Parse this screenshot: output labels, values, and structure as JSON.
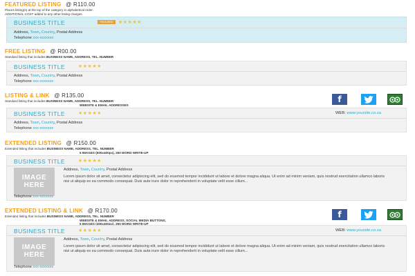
{
  "featured": {
    "title": "FEATURED LISTING",
    "price": "@ R110.00",
    "desc_line1": "Places listing(s) at the top of the category in alphabetical order.",
    "desc_line2": "ADDITIONAL COST added to any other listing charges.",
    "business_title": "BUSINESS TITLE",
    "badge": "FEATURED",
    "stars": "★★★★★",
    "address_prefix": "Address, ",
    "town": "Town",
    "comma1": ", ",
    "country": "Country",
    "address_suffix": ", Postal Address",
    "telephone_label": "Telephone ",
    "telephone_value": "xxx-xxxxxxx"
  },
  "free": {
    "title": "FREE LISTING",
    "price": "@ R00.00",
    "desc_prefix": "Standard listing that includes ",
    "desc_bold": "BUSINESS NAME, ADDRESS, TEL. NUMBER",
    "business_title": "BUSINESS TITLE",
    "stars": "★★★★★",
    "address_prefix": "Address, ",
    "town": "Town",
    "comma1": ", ",
    "country": "Country",
    "address_suffix": ", Postal Address",
    "telephone_label": "Telephone ",
    "telephone_value": "xxx-xxxxxxx"
  },
  "link": {
    "title": "LISTING & LINK",
    "price": "@ R135.00",
    "desc_prefix": "Standard listing that includes ",
    "desc_bold1": "BUSINESS NAME, ADDRESS, TEL. NUMBER",
    "desc_bold2": "WEBSITE & EMAIL ADDRESSES",
    "business_title": "BUSINESS TITLE",
    "stars": "★★★★★",
    "web_label": "WEB: ",
    "web_value": "www.yoursite.co.za",
    "address_prefix": "Address, ",
    "town": "Town",
    "comma1": ", ",
    "country": "Country",
    "address_suffix": ", Postal Address",
    "telephone_label": "Telephone ",
    "telephone_value": "xxx-xxxxxxx"
  },
  "extended": {
    "title": "EXTENDED LISTING",
    "price": "@ R150.00",
    "desc_prefix": "Extended listing that includes ",
    "desc_bold1": "BUSINESS NAME, ADDRESS, TEL. NUMBER",
    "desc_bold2": "5 IMAGES (500x400px), 250 WORD WRITE-UP",
    "business_title": "BUSINESS TITLE",
    "stars": "★★★★★",
    "image_line1": "IMAGE",
    "image_line2": "HERE",
    "address_prefix": "Address, ",
    "town": "Town",
    "comma1": ", ",
    "country": "Country",
    "address_suffix": ", Postal Address",
    "lorem": "Lorem ipsum dolor sit amet, consectetur adipiscing elit, sed do eiusmod tempor incididunt ut labore et dolore magna aliqua. Ut enim ad minim veniam, quis nostrud exercitation ullamco laboris nisi ut aliquip ex ea commodo consequat. Duis aute irure dolor in reprehenderit in voluptate velit esse cillum...",
    "telephone_label": "Telephone ",
    "telephone_value": "xxx-xxxxxxx"
  },
  "extlink": {
    "title": "EXTENDED LISTING & LINK",
    "price": "@ R170.00",
    "desc_prefix": "Extended listing that includes ",
    "desc_bold1": "BUSINESS NAME, ADDRESS, TEL. NUMBER",
    "desc_bold2": "WEBSITE & EMAIL ADDRESS, SOCIAL MEDIA BUTTONS,",
    "desc_bold3": "5 IMAGES (400x400px), 250 WORD WRITE-UP",
    "business_title": "BUSINESS TITLE",
    "stars": "★★★★★",
    "web_label": "WEB: ",
    "web_value": "www.yoursite.co.za",
    "image_line1": "IMAGE",
    "image_line2": "HERE",
    "address_prefix": "Address, ",
    "town": "Town",
    "comma1": ", ",
    "country": "Country",
    "address_suffix": ", Postal Address",
    "lorem": "Lorem ipsum dolor sit amet, consectetur adipiscing elit, sed do eiusmod tempor incididunt ut labore et dolore magna aliqua. Ut enim ad minim veniam, quis nostrud exercitation ullamco laboris nisi ut aliquip ex ea commodo consequat. Duis aute irure dolor in reprehenderit in voluptate velit esse cillum...",
    "telephone_label": "Telephone ",
    "telephone_value": "xxx-xxxxxxx"
  },
  "social": {
    "facebook_glyph": "f",
    "twitter_icon": "twitter-bird",
    "tripadvisor_icon": "tripadvisor-owl"
  },
  "colors": {
    "heading_accent": "#f39c12",
    "link_blue": "#2aa8c8",
    "featured_bg": "#d5eef4",
    "box_bg": "#f2f2f2",
    "star": "#f2c230"
  }
}
